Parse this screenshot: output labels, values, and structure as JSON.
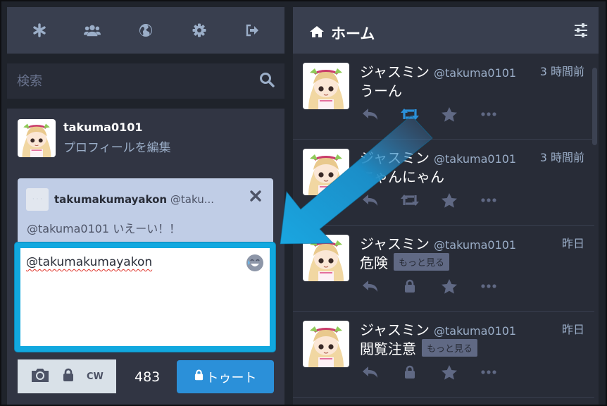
{
  "search": {
    "placeholder": "検索"
  },
  "account": {
    "username": "takuma0101",
    "edit_profile": "プロフィールを編集"
  },
  "reply": {
    "display_name": "takumakumayakon",
    "handle": "@taku...",
    "text": "@takuma0101 いえーい！！",
    "avatar_text": "· · ·"
  },
  "composer": {
    "value": "@takumakumayakon",
    "cw_label": "CW",
    "char_count": "483",
    "toot_label": "トゥート"
  },
  "column": {
    "title": "ホーム"
  },
  "statuses": [
    {
      "name": "ジャスミン",
      "acct": "@takuma0101",
      "time": "3 時間前",
      "content": "うーん",
      "more": "",
      "boosted": true,
      "locked": false
    },
    {
      "name": "ジャスミン",
      "acct": "@takuma0101",
      "time": "3 時間前",
      "content": "にゃんにゃん",
      "more": "",
      "boosted": false,
      "locked": false
    },
    {
      "name": "ジャスミン",
      "acct": "@takuma0101",
      "time": "昨日",
      "content": "危険",
      "more": "もっと見る",
      "boosted": false,
      "locked": true
    },
    {
      "name": "ジャスミン",
      "acct": "@takuma0101",
      "time": "昨日",
      "content": "閲覧注意",
      "more": "もっと見る",
      "boosted": false,
      "locked": true
    }
  ],
  "colors": {
    "accent": "#2b90d9",
    "boost_active": "#2b90d9",
    "highlight": "#11a8df",
    "icon": "#9baec8"
  }
}
